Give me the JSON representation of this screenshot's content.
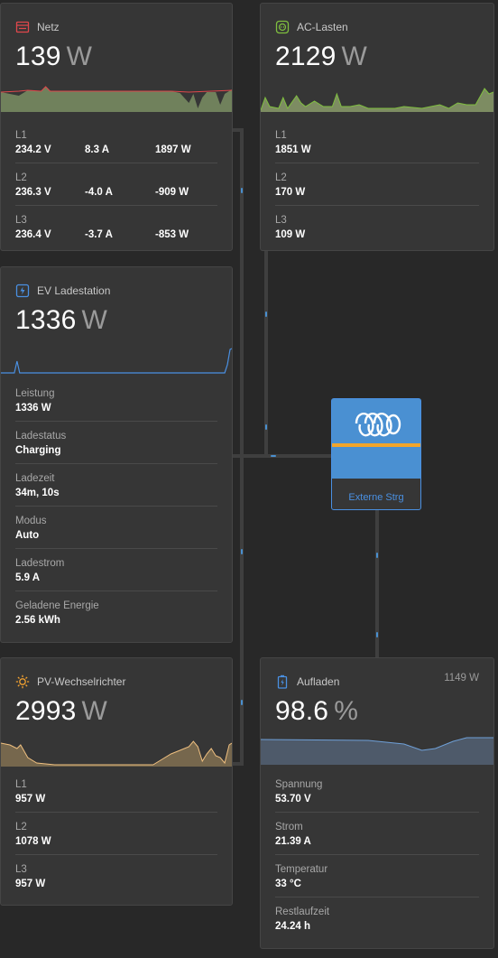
{
  "netz": {
    "title": "Netz",
    "value": "139",
    "unit": "W",
    "rows": [
      {
        "label": "L1",
        "voltage": "234.2 V",
        "current": "8.3 A",
        "power": "1897 W"
      },
      {
        "label": "L2",
        "voltage": "236.3 V",
        "current": "-4.0 A",
        "power": "-909 W"
      },
      {
        "label": "L3",
        "voltage": "236.4 V",
        "current": "-3.7 A",
        "power": "-853 W"
      }
    ]
  },
  "ac_lasten": {
    "title": "AC-Lasten",
    "value": "2129",
    "unit": "W",
    "rows": [
      {
        "label": "L1",
        "value": "1851 W"
      },
      {
        "label": "L2",
        "value": "170 W"
      },
      {
        "label": "L3",
        "value": "109 W"
      }
    ]
  },
  "ev": {
    "title": "EV Ladestation",
    "value": "1336",
    "unit": "W",
    "rows": [
      {
        "label": "Leistung",
        "value": "1336 W"
      },
      {
        "label": "Ladestatus",
        "value": "Charging"
      },
      {
        "label": "Ladezeit",
        "value": "34m, 10s"
      },
      {
        "label": "Modus",
        "value": "Auto"
      },
      {
        "label": "Ladestrom",
        "value": "5.9 A"
      },
      {
        "label": "Geladene Energie",
        "value": "2.56 kWh"
      }
    ]
  },
  "inverter": {
    "label": "Externe Strg"
  },
  "pv": {
    "title": "PV-Wechselrichter",
    "value": "2993",
    "unit": "W",
    "rows": [
      {
        "label": "L1",
        "value": "957 W"
      },
      {
        "label": "L2",
        "value": "1078 W"
      },
      {
        "label": "L3",
        "value": "957 W"
      }
    ]
  },
  "battery": {
    "title": "Aufladen",
    "power": "1149 W",
    "value": "98.6",
    "unit": "%",
    "rows": [
      {
        "label": "Spannung",
        "value": "53.70 V"
      },
      {
        "label": "Strom",
        "value": "21.39 A"
      },
      {
        "label": "Temperatur",
        "value": "33 °C"
      },
      {
        "label": "Restlaufzeit",
        "value": "24.24 h"
      }
    ]
  },
  "colors": {
    "grid": "#e0474c",
    "ac": "#7fbf3f",
    "ev": "#4a90e2",
    "pv": "#f0a030",
    "battery": "#4a90e2",
    "inverter": "#4a90d2",
    "inverter_stripe": "#f2a52b"
  },
  "icons": {
    "netz": "grid-icon",
    "ac": "socket-icon",
    "ev": "ev-charger-icon",
    "pv": "sun-icon",
    "battery": "battery-icon",
    "inverter": "victron-logo"
  }
}
